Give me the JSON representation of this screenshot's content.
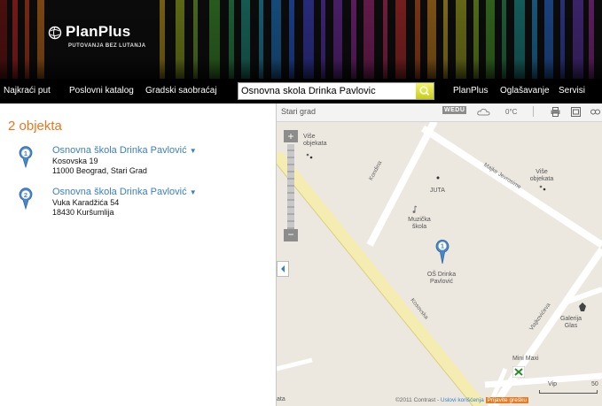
{
  "header": {
    "brand": "PlanPlus",
    "tagline": "PUTOVANJA BEZ LUTANJA"
  },
  "nav": {
    "items": [
      "Najkraći put",
      "Poslovni katalog",
      "Gradski saobraćaj"
    ],
    "search_value": "Osnovna skola Drinka Pavlovic",
    "right_items": [
      "PlanPlus",
      "Oglašavanje",
      "Servisi"
    ]
  },
  "results": {
    "count_label": "2 objekta",
    "items": [
      {
        "number": "1",
        "name": "Osnovna škola Drinka Pavlović",
        "street": "Kosovska 19",
        "city": "11000 Beograd, Stari Grad"
      },
      {
        "number": "2",
        "name": "Osnovna škola Drinka Pavlović",
        "street": "Vuka Karadžića 54",
        "city": "18430 Kuršumlija"
      }
    ]
  },
  "map": {
    "breadcrumb": "Stari grad",
    "weather_badge": "WEDU",
    "temperature": "0°C",
    "labels": {
      "vise_left": "Više objekata",
      "vise_right": "Više objekata",
      "juta": "JUTA",
      "muzicka": "Muzička škola",
      "os": "OŠ Drinka Pavlović",
      "galerija": "Galerija Glas",
      "mini_maxi": "Mini Maxi",
      "ata": "ata",
      "vip": "Vip",
      "scale": "50"
    },
    "roads": {
      "kondina": "Kondina",
      "majke": "Majke Jevrosime",
      "kosovska": "Kosovska",
      "vlajkoviceva": "Vlajkovićeva"
    },
    "pin_number": "1",
    "copyright": "©2011 Contrast -",
    "terms": "Uslovi korišćenja",
    "report": "Prijavite grešku"
  },
  "colors": {
    "accent": "#e8771f",
    "link": "#3a7fc2",
    "pin": "#4a86c8"
  }
}
